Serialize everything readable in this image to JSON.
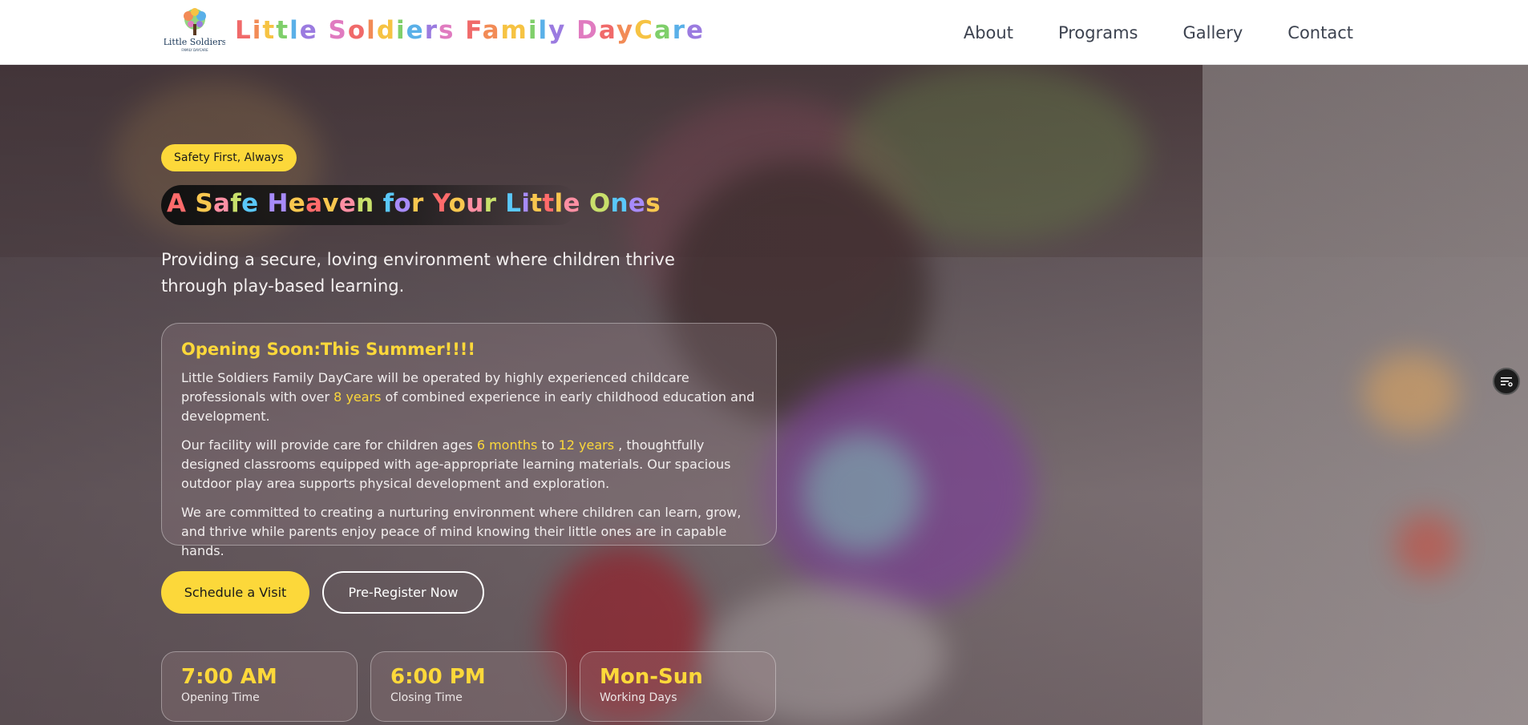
{
  "header": {
    "brand": "Little Soldiers Family DayCare",
    "logo_text": "Little Soldiers",
    "logo_subtext": "FAMILY DAYCARE",
    "nav": [
      {
        "label": "About"
      },
      {
        "label": "Programs"
      },
      {
        "label": "Gallery"
      },
      {
        "label": "Contact"
      }
    ]
  },
  "hero": {
    "badge": "Safety First, Always",
    "headline": "A Safe Heaven for Your Little Ones",
    "tagline": "Providing a secure, loving environment where children thrive through play-based learning.",
    "card": {
      "title": "Opening Soon:This Summer!!!!",
      "p1_pre": "Little Soldiers Family DayCare will be operated by highly experienced childcare professionals with over ",
      "p1_hl": "8 years",
      "p1_post": " of combined experience in early childhood education and development.",
      "p2_pre": "Our facility will provide care for children ages ",
      "p2_hl1": "6 months",
      "p2_mid": " to ",
      "p2_hl2": "12 years",
      "p2_post": " , thoughtfully designed classrooms equipped with age-appropriate learning materials. Our spacious outdoor play area supports physical development and exploration.",
      "p3": "We are committed to creating a nurturing environment where children can learn, grow, and thrive while parents enjoy peace of mind knowing their little ones are in capable hands."
    },
    "buttons": {
      "primary": "Schedule a Visit",
      "secondary": "Pre-Register Now"
    },
    "stats": [
      {
        "value": "7:00 AM",
        "label": "Opening Time"
      },
      {
        "value": "6:00 PM",
        "label": "Closing Time"
      },
      {
        "value": "Mon-Sun",
        "label": "Working Days"
      }
    ]
  },
  "icons": {
    "floating_button": "filter-list-icon"
  },
  "colors": {
    "accent": "#fcd83a",
    "brand_letters": [
      "#f06a6a",
      "#f28b56",
      "#f6c343",
      "#7fcf6b",
      "#5ab0e8",
      "#9b7be0",
      "#e07bc0"
    ],
    "headline_letters": [
      "#ff6b6b",
      "#f9c74f",
      "#ff8fa3",
      "#c8e06b",
      "#5ac8fa",
      "#a78bfa",
      "#f9c74f"
    ]
  }
}
